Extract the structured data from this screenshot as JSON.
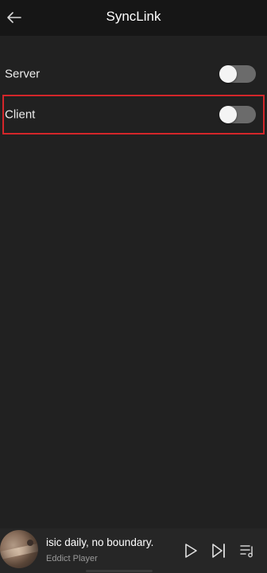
{
  "header": {
    "title": "SyncLink",
    "back_icon": "arrow-left-icon"
  },
  "settings": [
    {
      "label": "Server",
      "enabled": false
    },
    {
      "label": "Client",
      "enabled": false
    }
  ],
  "colors": {
    "background": "#212121",
    "header_background": "#161616",
    "toggle_track_off": "#6b6b6b",
    "toggle_knob": "#f4f4f4",
    "highlight": "#d3262a",
    "player_background": "#262626"
  },
  "player": {
    "title": "isic daily, no boundary.",
    "artist": "Eddict Player",
    "icons": {
      "play": "play-icon",
      "next": "skip-next-icon",
      "queue": "queue-music-icon"
    }
  }
}
